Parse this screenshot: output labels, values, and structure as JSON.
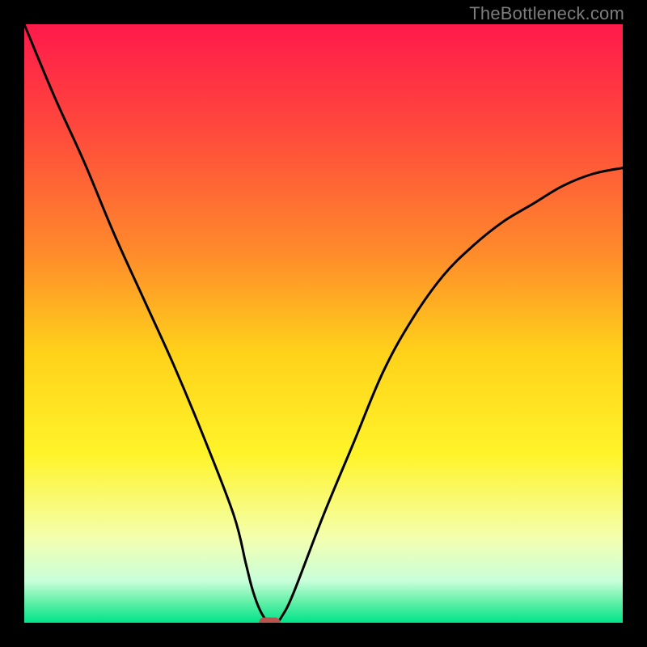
{
  "watermark": "TheBottleneck.com",
  "chart_data": {
    "type": "line",
    "title": "",
    "xlabel": "",
    "ylabel": "",
    "xlim": [
      0,
      100
    ],
    "ylim": [
      0,
      100
    ],
    "grid": false,
    "legend": false,
    "gradient_stops": [
      {
        "offset": 0.0,
        "color": "#ff1a4b"
      },
      {
        "offset": 0.18,
        "color": "#ff4a3c"
      },
      {
        "offset": 0.38,
        "color": "#ff8a2b"
      },
      {
        "offset": 0.55,
        "color": "#ffd21a"
      },
      {
        "offset": 0.72,
        "color": "#fff42a"
      },
      {
        "offset": 0.86,
        "color": "#f3ffb0"
      },
      {
        "offset": 0.93,
        "color": "#c9ffda"
      },
      {
        "offset": 0.965,
        "color": "#63f0a8"
      },
      {
        "offset": 1.0,
        "color": "#00e38a"
      }
    ],
    "x": [
      0,
      5,
      10,
      15,
      20,
      25,
      30,
      35,
      37,
      38,
      39,
      40,
      41,
      42,
      43,
      45,
      50,
      55,
      60,
      65,
      70,
      75,
      80,
      85,
      90,
      95,
      100
    ],
    "y": [
      100,
      88,
      77,
      65,
      54,
      43,
      31,
      18,
      10,
      6,
      3,
      1,
      0,
      0,
      1,
      5,
      18,
      30,
      42,
      51,
      58,
      63,
      67,
      70,
      73,
      75,
      76
    ],
    "vertex_x": 41,
    "marker": {
      "x": 41,
      "y": 0,
      "color": "#b9544f"
    }
  }
}
